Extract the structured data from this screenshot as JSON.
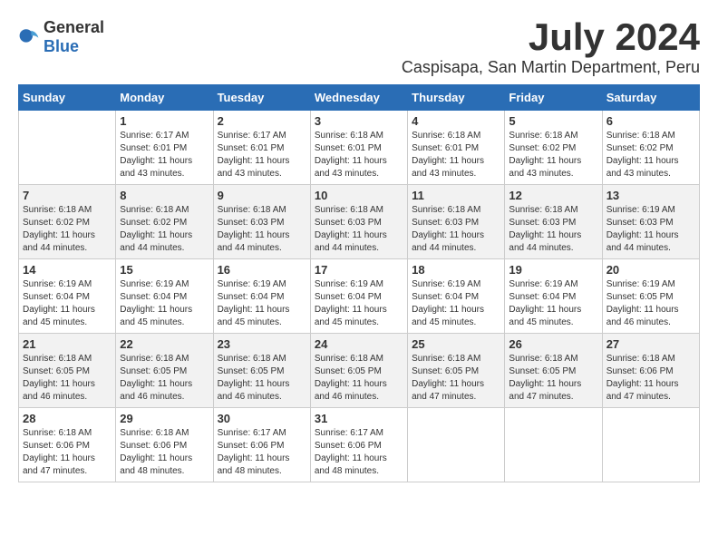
{
  "logo": {
    "general": "General",
    "blue": "Blue"
  },
  "title": "July 2024",
  "location": "Caspisapa, San Martin Department, Peru",
  "headers": [
    "Sunday",
    "Monday",
    "Tuesday",
    "Wednesday",
    "Thursday",
    "Friday",
    "Saturday"
  ],
  "weeks": [
    [
      {
        "day": "",
        "info": ""
      },
      {
        "day": "1",
        "info": "Sunrise: 6:17 AM\nSunset: 6:01 PM\nDaylight: 11 hours\nand 43 minutes."
      },
      {
        "day": "2",
        "info": "Sunrise: 6:17 AM\nSunset: 6:01 PM\nDaylight: 11 hours\nand 43 minutes."
      },
      {
        "day": "3",
        "info": "Sunrise: 6:18 AM\nSunset: 6:01 PM\nDaylight: 11 hours\nand 43 minutes."
      },
      {
        "day": "4",
        "info": "Sunrise: 6:18 AM\nSunset: 6:01 PM\nDaylight: 11 hours\nand 43 minutes."
      },
      {
        "day": "5",
        "info": "Sunrise: 6:18 AM\nSunset: 6:02 PM\nDaylight: 11 hours\nand 43 minutes."
      },
      {
        "day": "6",
        "info": "Sunrise: 6:18 AM\nSunset: 6:02 PM\nDaylight: 11 hours\nand 43 minutes."
      }
    ],
    [
      {
        "day": "7",
        "info": "Sunrise: 6:18 AM\nSunset: 6:02 PM\nDaylight: 11 hours\nand 44 minutes."
      },
      {
        "day": "8",
        "info": "Sunrise: 6:18 AM\nSunset: 6:02 PM\nDaylight: 11 hours\nand 44 minutes."
      },
      {
        "day": "9",
        "info": "Sunrise: 6:18 AM\nSunset: 6:03 PM\nDaylight: 11 hours\nand 44 minutes."
      },
      {
        "day": "10",
        "info": "Sunrise: 6:18 AM\nSunset: 6:03 PM\nDaylight: 11 hours\nand 44 minutes."
      },
      {
        "day": "11",
        "info": "Sunrise: 6:18 AM\nSunset: 6:03 PM\nDaylight: 11 hours\nand 44 minutes."
      },
      {
        "day": "12",
        "info": "Sunrise: 6:18 AM\nSunset: 6:03 PM\nDaylight: 11 hours\nand 44 minutes."
      },
      {
        "day": "13",
        "info": "Sunrise: 6:19 AM\nSunset: 6:03 PM\nDaylight: 11 hours\nand 44 minutes."
      }
    ],
    [
      {
        "day": "14",
        "info": "Sunrise: 6:19 AM\nSunset: 6:04 PM\nDaylight: 11 hours\nand 45 minutes."
      },
      {
        "day": "15",
        "info": "Sunrise: 6:19 AM\nSunset: 6:04 PM\nDaylight: 11 hours\nand 45 minutes."
      },
      {
        "day": "16",
        "info": "Sunrise: 6:19 AM\nSunset: 6:04 PM\nDaylight: 11 hours\nand 45 minutes."
      },
      {
        "day": "17",
        "info": "Sunrise: 6:19 AM\nSunset: 6:04 PM\nDaylight: 11 hours\nand 45 minutes."
      },
      {
        "day": "18",
        "info": "Sunrise: 6:19 AM\nSunset: 6:04 PM\nDaylight: 11 hours\nand 45 minutes."
      },
      {
        "day": "19",
        "info": "Sunrise: 6:19 AM\nSunset: 6:04 PM\nDaylight: 11 hours\nand 45 minutes."
      },
      {
        "day": "20",
        "info": "Sunrise: 6:19 AM\nSunset: 6:05 PM\nDaylight: 11 hours\nand 46 minutes."
      }
    ],
    [
      {
        "day": "21",
        "info": "Sunrise: 6:18 AM\nSunset: 6:05 PM\nDaylight: 11 hours\nand 46 minutes."
      },
      {
        "day": "22",
        "info": "Sunrise: 6:18 AM\nSunset: 6:05 PM\nDaylight: 11 hours\nand 46 minutes."
      },
      {
        "day": "23",
        "info": "Sunrise: 6:18 AM\nSunset: 6:05 PM\nDaylight: 11 hours\nand 46 minutes."
      },
      {
        "day": "24",
        "info": "Sunrise: 6:18 AM\nSunset: 6:05 PM\nDaylight: 11 hours\nand 46 minutes."
      },
      {
        "day": "25",
        "info": "Sunrise: 6:18 AM\nSunset: 6:05 PM\nDaylight: 11 hours\nand 47 minutes."
      },
      {
        "day": "26",
        "info": "Sunrise: 6:18 AM\nSunset: 6:05 PM\nDaylight: 11 hours\nand 47 minutes."
      },
      {
        "day": "27",
        "info": "Sunrise: 6:18 AM\nSunset: 6:06 PM\nDaylight: 11 hours\nand 47 minutes."
      }
    ],
    [
      {
        "day": "28",
        "info": "Sunrise: 6:18 AM\nSunset: 6:06 PM\nDaylight: 11 hours\nand 47 minutes."
      },
      {
        "day": "29",
        "info": "Sunrise: 6:18 AM\nSunset: 6:06 PM\nDaylight: 11 hours\nand 48 minutes."
      },
      {
        "day": "30",
        "info": "Sunrise: 6:17 AM\nSunset: 6:06 PM\nDaylight: 11 hours\nand 48 minutes."
      },
      {
        "day": "31",
        "info": "Sunrise: 6:17 AM\nSunset: 6:06 PM\nDaylight: 11 hours\nand 48 minutes."
      },
      {
        "day": "",
        "info": ""
      },
      {
        "day": "",
        "info": ""
      },
      {
        "day": "",
        "info": ""
      }
    ]
  ]
}
